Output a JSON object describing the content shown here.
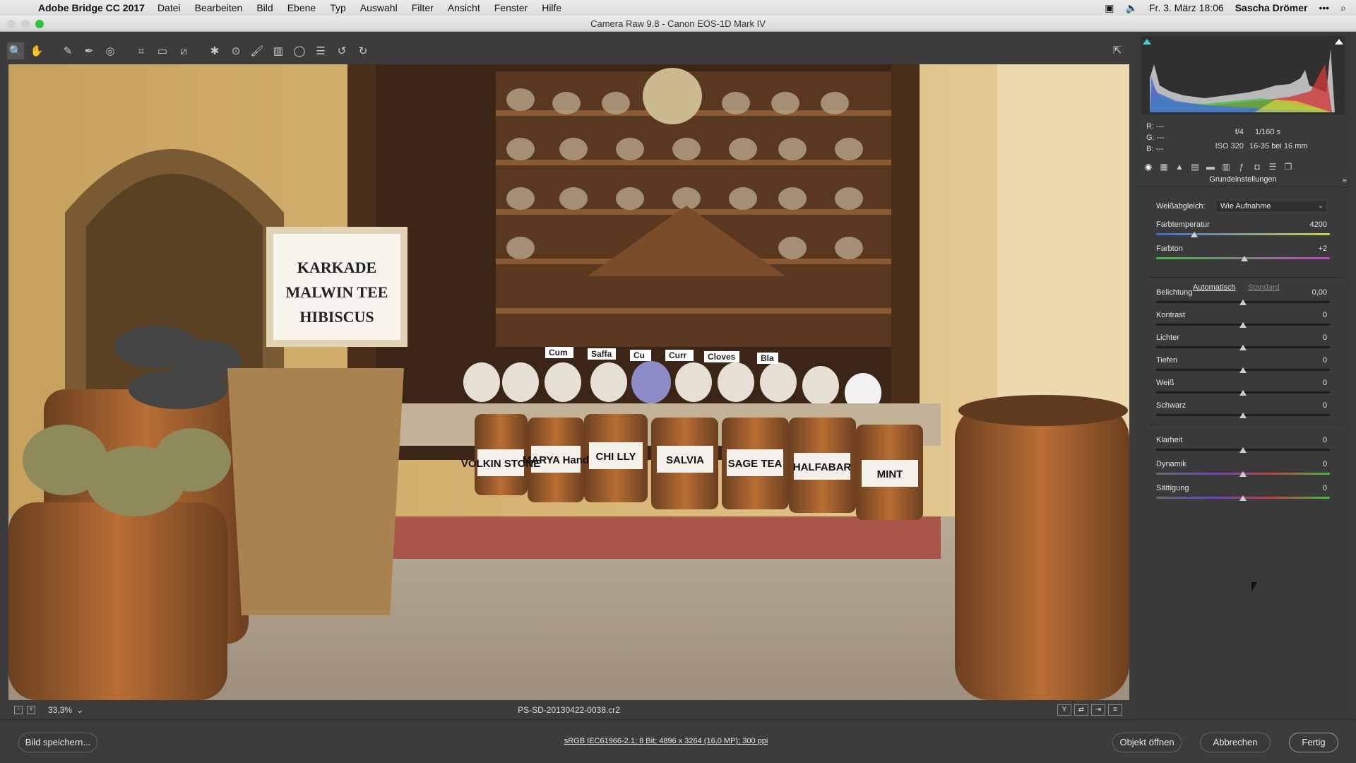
{
  "menubar": {
    "app_name": "Adobe Bridge CC 2017",
    "items": [
      "Datei",
      "Bearbeiten",
      "Bild",
      "Ebene",
      "Typ",
      "Auswahl",
      "Filter",
      "Ansicht",
      "Fenster",
      "Hilfe"
    ],
    "datetime": "Fr. 3. März  18:06",
    "user": "Sascha Drömer",
    "more": "•••"
  },
  "window": {
    "title": "Camera Raw 9.8  -  Canon EOS-1D Mark IV"
  },
  "preview": {
    "sign_lines": [
      "KARKADE",
      "MALWIN TEE",
      "HIBISCUS"
    ],
    "barrel_labels": [
      "VOLKIN STONE",
      "MARYA Hand",
      "CHI LLY",
      "SALVIA",
      "SAGE TEA",
      "HALFABAR",
      "MINT"
    ],
    "jar_labels": [
      "Cum",
      "Saffa",
      "Cu",
      "Curr",
      "Cloves",
      "Bla"
    ]
  },
  "statusbar": {
    "zoom": "33,3%",
    "filename": "PS-SD-20130422-0038.cr2"
  },
  "bottom": {
    "save_label": "Bild speichern...",
    "workflow": "sRGB IEC61966-2.1; 8 Bit; 4896 x 3264 (16,0 MP); 300 ppi",
    "open_label": "Objekt öffnen",
    "cancel_label": "Abbrechen",
    "done_label": "Fertig"
  },
  "panel": {
    "readout": {
      "r": "R:  ---",
      "g": "G:  ---",
      "b": "B:  ---",
      "aperture": "f/4",
      "shutter": "1/160 s",
      "iso": "ISO 320",
      "lens": "16-35 bei 16 mm"
    },
    "title": "Grundeinstellungen",
    "wb_label": "Weißabgleich:",
    "wb_value": "Wie Aufnahme",
    "link_auto": "Automatisch",
    "link_default": "Standard",
    "sliders": [
      {
        "label": "Farbtemperatur",
        "value": "4200",
        "fraction": 0.22
      },
      {
        "label": "Farbton",
        "value": "+2",
        "fraction": 0.51
      },
      {
        "label": "Belichtung",
        "value": "0,00",
        "fraction": 0.5
      },
      {
        "label": "Kontrast",
        "value": "0",
        "fraction": 0.5
      },
      {
        "label": "Lichter",
        "value": "0",
        "fraction": 0.5
      },
      {
        "label": "Tiefen",
        "value": "0",
        "fraction": 0.5
      },
      {
        "label": "Weiß",
        "value": "0",
        "fraction": 0.5
      },
      {
        "label": "Schwarz",
        "value": "0",
        "fraction": 0.5
      },
      {
        "label": "Klarheit",
        "value": "0",
        "fraction": 0.5
      },
      {
        "label": "Dynamik",
        "value": "0",
        "fraction": 0.5
      },
      {
        "label": "Sättigung",
        "value": "0",
        "fraction": 0.5
      }
    ]
  },
  "colors": {
    "accent_green": "#2dc840",
    "panel_bg": "#3a3a3a",
    "temp_track": "linear-gradient(90deg,#3a6fd1,#cfcf4a)",
    "tint_track": "linear-gradient(90deg,#3fbf3f,#c23fc2)",
    "vib_track": "linear-gradient(90deg,#6a6a6a,#6a43c4,#c23f3f,#3fbf3f)"
  }
}
